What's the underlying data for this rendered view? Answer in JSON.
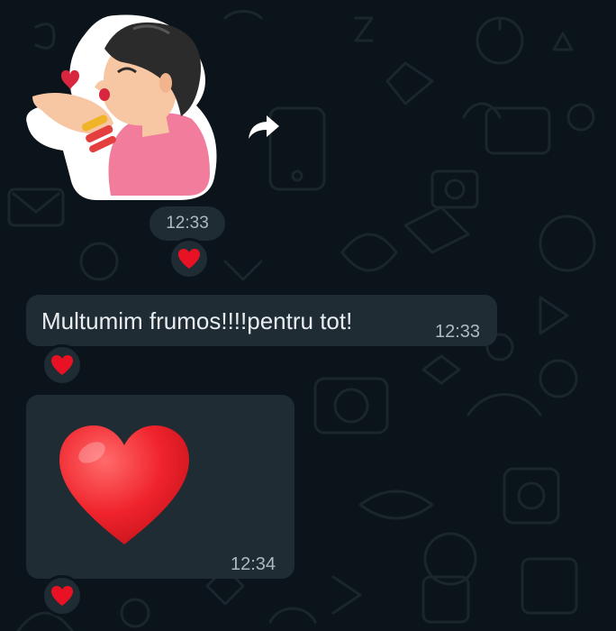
{
  "theme": {
    "background": "#0b141a",
    "bubble": "#1f2c34",
    "text": "#e9edef",
    "meta_text": "#aebac1",
    "heart": "#e81224"
  },
  "messages": [
    {
      "type": "sticker",
      "sticker_icon": "woman-blowing-kiss-sticker",
      "time": "12:33",
      "reaction": "heart"
    },
    {
      "type": "text",
      "text": "Multumim frumos!!!!pentru tot!",
      "time": "12:33",
      "reaction": "heart"
    },
    {
      "type": "emoji",
      "emoji_icon": "red-heart-emoji",
      "time": "12:34",
      "reaction": "heart"
    }
  ],
  "actions": {
    "forward_icon": "forward-arrow-icon"
  }
}
